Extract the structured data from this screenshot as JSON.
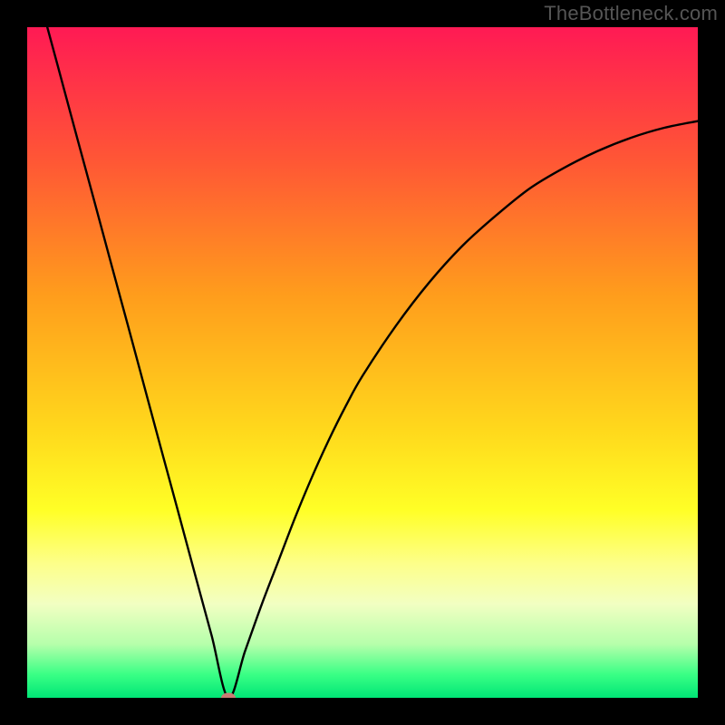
{
  "watermark": "TheBottleneck.com",
  "chart_data": {
    "type": "line",
    "title": "",
    "xlabel": "",
    "ylabel": "",
    "xlim": [
      0,
      100
    ],
    "ylim": [
      0,
      100
    ],
    "grid": false,
    "legend": false,
    "notes": "V-shaped curve over a vertical rainbow gradient background (red top through orange/yellow to green bottom). Single minimum marker near x≈30, y≈0. No axis ticks or labels; black border.",
    "series": [
      {
        "name": "curve",
        "x": [
          3,
          5,
          7.5,
          10,
          12.5,
          15,
          17.5,
          20,
          22.5,
          25,
          27.5,
          30,
          32.5,
          35,
          37.5,
          40,
          42.5,
          45,
          47.5,
          50,
          55,
          60,
          65,
          70,
          75,
          80,
          85,
          90,
          95,
          100
        ],
        "y": [
          100,
          92.6,
          83.3,
          74.1,
          64.8,
          55.6,
          46.3,
          37.0,
          27.8,
          18.5,
          9.3,
          0,
          7.0,
          14.0,
          20.5,
          27.0,
          33.0,
          38.5,
          43.5,
          48.0,
          55.5,
          62.0,
          67.5,
          72.0,
          76.0,
          79.0,
          81.5,
          83.5,
          85.0,
          86.0
        ]
      }
    ],
    "markers": [
      {
        "name": "minimum",
        "x": 30,
        "y": 0,
        "color": "#c97b73"
      }
    ],
    "background_gradient": {
      "direction": "vertical",
      "stops": [
        {
          "pos": 0.0,
          "color": "#ff1a54"
        },
        {
          "pos": 0.2,
          "color": "#ff5735"
        },
        {
          "pos": 0.4,
          "color": "#ff9d1c"
        },
        {
          "pos": 0.6,
          "color": "#ffd81c"
        },
        {
          "pos": 0.72,
          "color": "#ffff26"
        },
        {
          "pos": 0.8,
          "color": "#fdff8a"
        },
        {
          "pos": 0.86,
          "color": "#f2ffc2"
        },
        {
          "pos": 0.92,
          "color": "#b6ffab"
        },
        {
          "pos": 0.965,
          "color": "#3aff85"
        },
        {
          "pos": 1.0,
          "color": "#00e676"
        }
      ]
    }
  }
}
